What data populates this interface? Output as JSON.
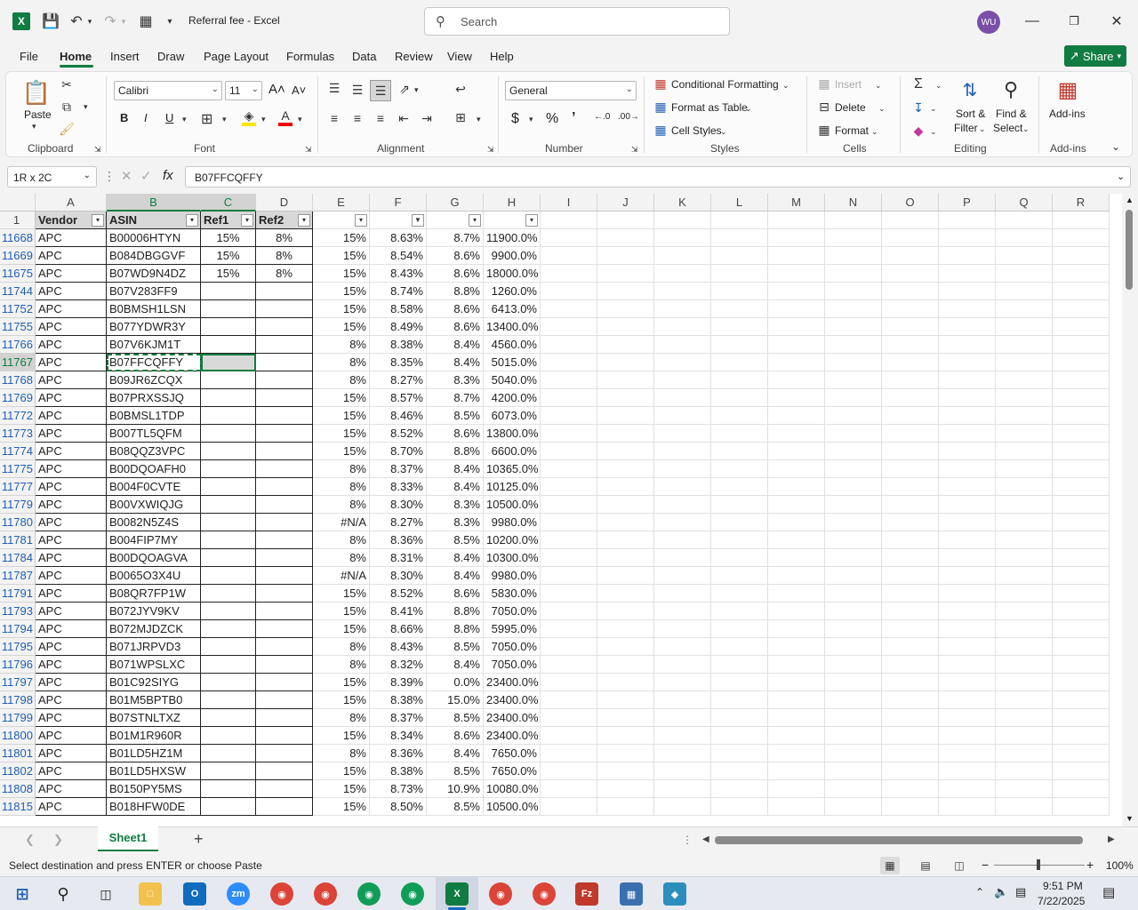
{
  "title": {
    "doc": "Referral fee  -  Excel"
  },
  "search": {
    "placeholder": "Search"
  },
  "user": {
    "initials": "WU"
  },
  "menu": [
    "File",
    "Home",
    "Insert",
    "Draw",
    "Page Layout",
    "Formulas",
    "Data",
    "Review",
    "View",
    "Help"
  ],
  "share": "Share",
  "ribbon": {
    "clipboard": {
      "label": "Clipboard",
      "paste": "Paste"
    },
    "font": {
      "label": "Font",
      "name": "Calibri",
      "size": "11"
    },
    "alignment": {
      "label": "Alignment"
    },
    "number": {
      "label": "Number",
      "format": "General"
    },
    "styles": {
      "label": "Styles",
      "cond": "Conditional Formatting",
      "table": "Format as Table",
      "cell": "Cell Styles"
    },
    "cells": {
      "label": "Cells",
      "insert": "Insert",
      "delete": "Delete",
      "format": "Format"
    },
    "editing": {
      "label": "Editing",
      "sort": "Sort &",
      "sort2": "Filter",
      "find": "Find &",
      "find2": "Select"
    },
    "addins": {
      "label": "Add-ins",
      "btn": "Add-ins"
    }
  },
  "namebox": "1R x 2C",
  "formula": "B07FFCQFFY",
  "columns": [
    "A",
    "B",
    "C",
    "D",
    "E",
    "F",
    "G",
    "H",
    "I",
    "J",
    "K",
    "L",
    "M",
    "N",
    "O",
    "P",
    "Q",
    "R"
  ],
  "header_row": {
    "num": "1",
    "A": "Vendor",
    "B": "ASIN",
    "C": "Ref1",
    "D": "Ref2"
  },
  "rows": [
    {
      "n": "11668",
      "a": "APC",
      "b": "B00006HTYN",
      "c": "15%",
      "d": "8%",
      "e": "15%",
      "f": "8.63%",
      "g": "8.7%",
      "h": "11900.0%"
    },
    {
      "n": "11669",
      "a": "APC",
      "b": "B084DBGGVF",
      "c": "15%",
      "d": "8%",
      "e": "15%",
      "f": "8.54%",
      "g": "8.6%",
      "h": "9900.0%"
    },
    {
      "n": "11675",
      "a": "APC",
      "b": "B07WD9N4DZ",
      "c": "15%",
      "d": "8%",
      "e": "15%",
      "f": "8.43%",
      "g": "8.6%",
      "h": "18000.0%"
    },
    {
      "n": "11744",
      "a": "APC",
      "b": "B07V283FF9",
      "c": "",
      "d": "",
      "e": "15%",
      "f": "8.74%",
      "g": "8.8%",
      "h": "1260.0%"
    },
    {
      "n": "11752",
      "a": "APC",
      "b": "B0BMSH1LSN",
      "c": "",
      "d": "",
      "e": "15%",
      "f": "8.58%",
      "g": "8.6%",
      "h": "6413.0%"
    },
    {
      "n": "11755",
      "a": "APC",
      "b": "B077YDWR3Y",
      "c": "",
      "d": "",
      "e": "15%",
      "f": "8.49%",
      "g": "8.6%",
      "h": "13400.0%"
    },
    {
      "n": "11766",
      "a": "APC",
      "b": "B07V6KJM1T",
      "c": "",
      "d": "",
      "e": "8%",
      "f": "8.38%",
      "g": "8.4%",
      "h": "4560.0%"
    },
    {
      "n": "11767",
      "a": "APC",
      "b": "B07FFCQFFY",
      "c": "",
      "d": "",
      "e": "8%",
      "f": "8.35%",
      "g": "8.4%",
      "h": "5015.0%"
    },
    {
      "n": "11768",
      "a": "APC",
      "b": "B09JR6ZCQX",
      "c": "",
      "d": "",
      "e": "8%",
      "f": "8.27%",
      "g": "8.3%",
      "h": "5040.0%"
    },
    {
      "n": "11769",
      "a": "APC",
      "b": "B07PRXSSJQ",
      "c": "",
      "d": "",
      "e": "15%",
      "f": "8.57%",
      "g": "8.7%",
      "h": "4200.0%"
    },
    {
      "n": "11772",
      "a": "APC",
      "b": "B0BMSL1TDP",
      "c": "",
      "d": "",
      "e": "15%",
      "f": "8.46%",
      "g": "8.5%",
      "h": "6073.0%"
    },
    {
      "n": "11773",
      "a": "APC",
      "b": "B007TL5QFM",
      "c": "",
      "d": "",
      "e": "15%",
      "f": "8.52%",
      "g": "8.6%",
      "h": "13800.0%"
    },
    {
      "n": "11774",
      "a": "APC",
      "b": "B08QQZ3VPC",
      "c": "",
      "d": "",
      "e": "15%",
      "f": "8.70%",
      "g": "8.8%",
      "h": "6600.0%"
    },
    {
      "n": "11775",
      "a": "APC",
      "b": "B00DQOAFH0",
      "c": "",
      "d": "",
      "e": "8%",
      "f": "8.37%",
      "g": "8.4%",
      "h": "10365.0%"
    },
    {
      "n": "11777",
      "a": "APC",
      "b": "B004F0CVTE",
      "c": "",
      "d": "",
      "e": "8%",
      "f": "8.33%",
      "g": "8.4%",
      "h": "10125.0%"
    },
    {
      "n": "11779",
      "a": "APC",
      "b": "B00VXWIQJG",
      "c": "",
      "d": "",
      "e": "8%",
      "f": "8.30%",
      "g": "8.3%",
      "h": "10500.0%"
    },
    {
      "n": "11780",
      "a": "APC",
      "b": "B0082N5Z4S",
      "c": "",
      "d": "",
      "e": "#N/A",
      "f": "8.27%",
      "g": "8.3%",
      "h": "9980.0%"
    },
    {
      "n": "11781",
      "a": "APC",
      "b": "B004FIP7MY",
      "c": "",
      "d": "",
      "e": "8%",
      "f": "8.36%",
      "g": "8.5%",
      "h": "10200.0%"
    },
    {
      "n": "11784",
      "a": "APC",
      "b": "B00DQOAGVA",
      "c": "",
      "d": "",
      "e": "8%",
      "f": "8.31%",
      "g": "8.4%",
      "h": "10300.0%"
    },
    {
      "n": "11787",
      "a": "APC",
      "b": "B0065O3X4U",
      "c": "",
      "d": "",
      "e": "#N/A",
      "f": "8.30%",
      "g": "8.4%",
      "h": "9980.0%"
    },
    {
      "n": "11791",
      "a": "APC",
      "b": "B08QR7FP1W",
      "c": "",
      "d": "",
      "e": "15%",
      "f": "8.52%",
      "g": "8.6%",
      "h": "5830.0%"
    },
    {
      "n": "11793",
      "a": "APC",
      "b": "B072JYV9KV",
      "c": "",
      "d": "",
      "e": "15%",
      "f": "8.41%",
      "g": "8.8%",
      "h": "7050.0%"
    },
    {
      "n": "11794",
      "a": "APC",
      "b": "B072MJDZCK",
      "c": "",
      "d": "",
      "e": "15%",
      "f": "8.66%",
      "g": "8.8%",
      "h": "5995.0%"
    },
    {
      "n": "11795",
      "a": "APC",
      "b": "B071JRPVD3",
      "c": "",
      "d": "",
      "e": "8%",
      "f": "8.43%",
      "g": "8.5%",
      "h": "7050.0%"
    },
    {
      "n": "11796",
      "a": "APC",
      "b": "B071WPSLXC",
      "c": "",
      "d": "",
      "e": "8%",
      "f": "8.32%",
      "g": "8.4%",
      "h": "7050.0%"
    },
    {
      "n": "11797",
      "a": "APC",
      "b": "B01C92SIYG",
      "c": "",
      "d": "",
      "e": "15%",
      "f": "8.39%",
      "g": "0.0%",
      "h": "23400.0%"
    },
    {
      "n": "11798",
      "a": "APC",
      "b": "B01M5BPTB0",
      "c": "",
      "d": "",
      "e": "15%",
      "f": "8.38%",
      "g": "15.0%",
      "h": "23400.0%"
    },
    {
      "n": "11799",
      "a": "APC",
      "b": "B07STNLTXZ",
      "c": "",
      "d": "",
      "e": "8%",
      "f": "8.37%",
      "g": "8.5%",
      "h": "23400.0%"
    },
    {
      "n": "11800",
      "a": "APC",
      "b": "B01M1R960R",
      "c": "",
      "d": "",
      "e": "15%",
      "f": "8.34%",
      "g": "8.6%",
      "h": "23400.0%"
    },
    {
      "n": "11801",
      "a": "APC",
      "b": "B01LD5HZ1M",
      "c": "",
      "d": "",
      "e": "8%",
      "f": "8.36%",
      "g": "8.4%",
      "h": "7650.0%"
    },
    {
      "n": "11802",
      "a": "APC",
      "b": "B01LD5HXSW",
      "c": "",
      "d": "",
      "e": "15%",
      "f": "8.38%",
      "g": "8.5%",
      "h": "7650.0%"
    },
    {
      "n": "11808",
      "a": "APC",
      "b": "B0150PY5MS",
      "c": "",
      "d": "",
      "e": "15%",
      "f": "8.73%",
      "g": "10.9%",
      "h": "10080.0%"
    },
    {
      "n": "11815",
      "a": "APC",
      "b": "B018HFW0DE",
      "c": "",
      "d": "",
      "e": "15%",
      "f": "8.50%",
      "g": "8.5%",
      "h": "10500.0%"
    }
  ],
  "sheet": {
    "name": "Sheet1"
  },
  "status": {
    "message": "Select destination and press ENTER or choose Paste",
    "zoom": "100%"
  },
  "clock": {
    "time": "9:51 PM",
    "date": "7/22/2025"
  },
  "colors": {
    "accent": "#107c41"
  }
}
